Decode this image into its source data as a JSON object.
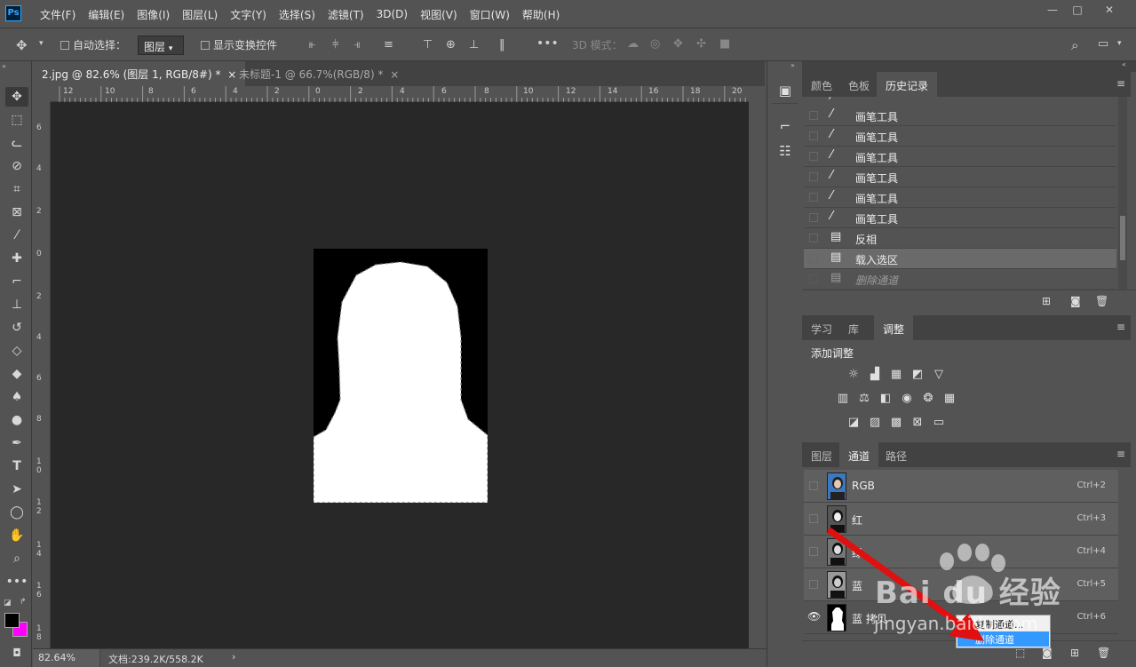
{
  "app": {
    "logo": "Ps"
  },
  "menu": [
    "文件(F)",
    "编辑(E)",
    "图像(I)",
    "图层(L)",
    "文字(Y)",
    "选择(S)",
    "滤镜(T)",
    "3D(D)",
    "视图(V)",
    "窗口(W)",
    "帮助(H)"
  ],
  "window_controls": {
    "minimize": "—",
    "restore": "□",
    "close": "✕"
  },
  "options": {
    "auto_select_label": "自动选择：",
    "auto_select_value": "图层",
    "show_transform_label": "显示变换控件",
    "mode_3d_label": "3D 模式："
  },
  "tabs": [
    {
      "label": "2.jpg @ 82.6% (图层 1, RGB/8#) *",
      "close": "×",
      "active": true
    },
    {
      "label": "未标题-1 @ 66.7%(RGB/8) *",
      "close": "×",
      "active": false
    }
  ],
  "ruler": {
    "top": [
      "12",
      "10",
      "8",
      "6",
      "4",
      "2",
      "0",
      "2",
      "4",
      "6",
      "8",
      "10",
      "12",
      "14",
      "16",
      "18",
      "20"
    ],
    "left": [
      "6",
      "4",
      "2",
      "0",
      "2",
      "4",
      "6",
      "8",
      "1 0",
      "1 2",
      "1 4",
      "1 6",
      "1 8"
    ]
  },
  "status": {
    "zoom": "82.64%",
    "doc": "文档:239.2K/558.2K",
    "arrow": "›"
  },
  "history_panel": {
    "tabs": [
      "颜色",
      "色板",
      "历史记录"
    ],
    "active_tab": "历史记录",
    "items": [
      {
        "icon": "brush-icon",
        "label": "画笔工具"
      },
      {
        "icon": "brush-icon",
        "label": "画笔工具"
      },
      {
        "icon": "brush-icon",
        "label": "画笔工具"
      },
      {
        "icon": "brush-icon",
        "label": "画笔工具"
      },
      {
        "icon": "brush-icon",
        "label": "画笔工具"
      },
      {
        "icon": "brush-icon",
        "label": "画笔工具"
      },
      {
        "icon": "document-icon",
        "label": "反相"
      },
      {
        "icon": "document-icon",
        "label": "载入选区"
      },
      {
        "icon": "document-icon",
        "label": "删除通道"
      }
    ]
  },
  "adjust_panel": {
    "tabs": [
      "学习",
      "库",
      "调整"
    ],
    "active_tab": "调整",
    "heading": "添加调整"
  },
  "channels_panel": {
    "tabs": [
      "图层",
      "通道",
      "路径"
    ],
    "active_tab": "通道",
    "channels": [
      {
        "name": "RGB",
        "shortcut": "Ctrl+2",
        "visible": false
      },
      {
        "name": "红",
        "shortcut": "Ctrl+3",
        "visible": false
      },
      {
        "name": "绿",
        "shortcut": "Ctrl+4",
        "visible": false
      },
      {
        "name": "蓝",
        "shortcut": "Ctrl+5",
        "visible": false
      },
      {
        "name": "蓝 拷贝",
        "shortcut": "Ctrl+6",
        "visible": true
      }
    ]
  },
  "context_menu": {
    "items": [
      "复制通道...",
      "删除通道"
    ],
    "highlighted": "删除通道"
  },
  "watermark": {
    "brand": "Bai du 经验",
    "url": "jingyan.baidu.com"
  },
  "colors": {
    "accent": "#31a8ff",
    "foreground": "#000000",
    "background": "#ff00ff",
    "arrow": "#e01010"
  }
}
